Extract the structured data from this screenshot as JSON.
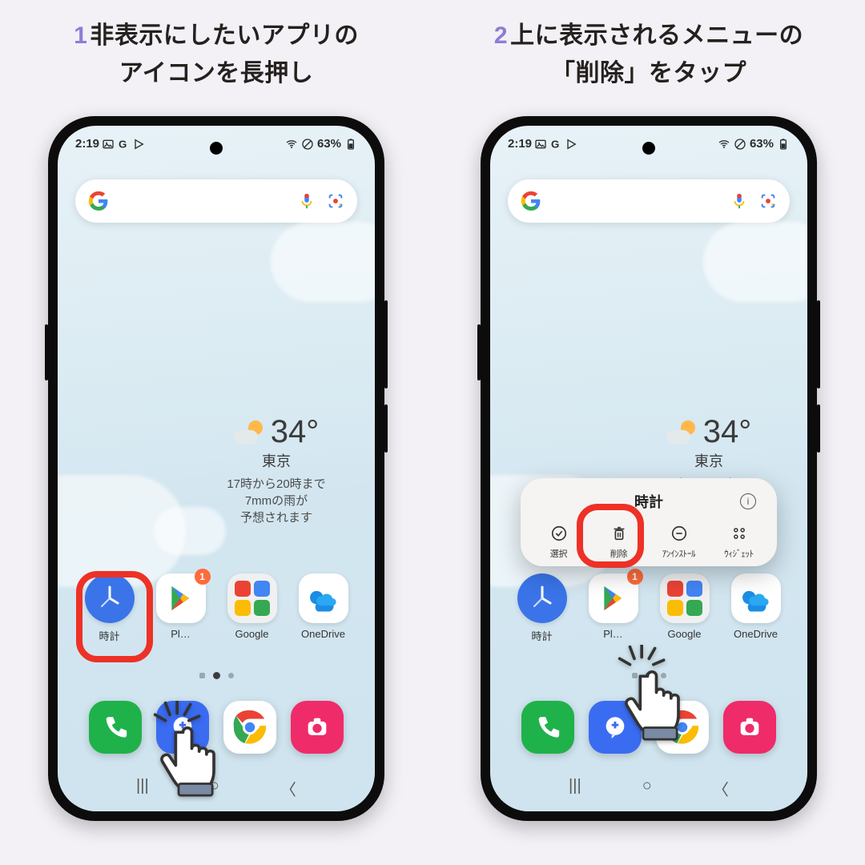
{
  "steps": [
    {
      "num": "1",
      "line1": "非表示にしたいアプリの",
      "line2": "アイコンを長押し"
    },
    {
      "num": "2",
      "line1": "上に表示されるメニューの",
      "line2": "「削除」をタップ"
    }
  ],
  "status": {
    "time": "2:19",
    "battery": "63%"
  },
  "weather": {
    "temp": "34°",
    "city": "東京",
    "line1": "17時から20時まで",
    "line2": "7mmの雨が",
    "line3": "予想されます"
  },
  "apps": {
    "clock": "時計",
    "play": "Pl…",
    "play_badge": "1",
    "google": "Google",
    "onedrive": "OneDrive"
  },
  "popup": {
    "title": "時計",
    "select": "選択",
    "remove": "削除",
    "uninstall": "ｱﾝｲﾝｽﾄｰﾙ",
    "widget": "ｳｨｼﾞｪｯﾄ"
  }
}
